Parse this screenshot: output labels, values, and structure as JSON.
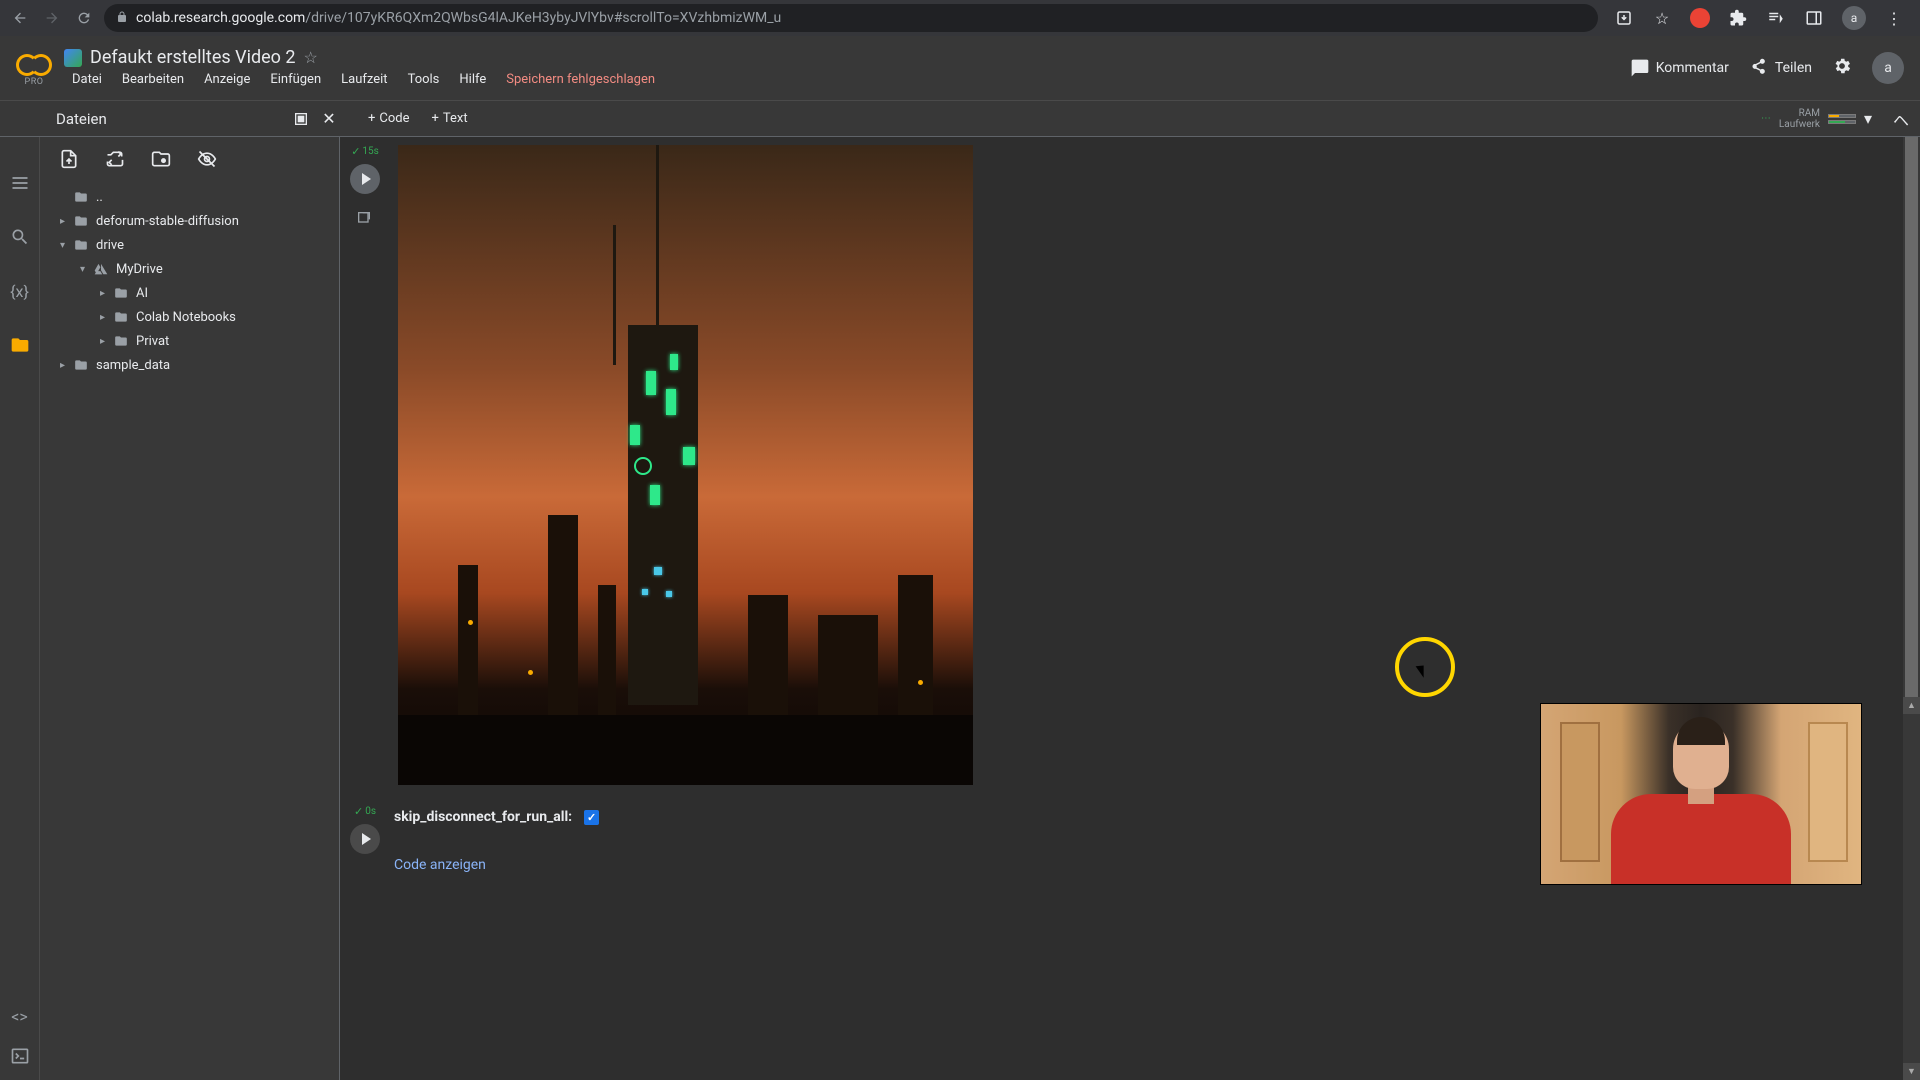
{
  "browser": {
    "url_prefix": "colab.research.google.com",
    "url_path": "/drive/107yKR6QXm2QWbsG4lAJKeH3ybyJVlYbv#scrollTo=XVzhbmizWM_u",
    "avatar_letter": "a"
  },
  "header": {
    "pro_badge": "PRO",
    "doc_title": "Defaukt erstelltes Video 2",
    "menus": [
      "Datei",
      "Bearbeiten",
      "Anzeige",
      "Einfügen",
      "Laufzeit",
      "Tools",
      "Hilfe"
    ],
    "save_error": "Speichern fehlgeschlagen",
    "kommentar": "Kommentar",
    "teilen": "Teilen",
    "avatar_letter": "a"
  },
  "toolbar": {
    "code_btn": "Code",
    "text_btn": "Text",
    "ram_label": "RAM",
    "disk_label": "Laufwerk"
  },
  "files_panel": {
    "title": "Dateien",
    "tree": {
      "up": "..",
      "deforum": "deforum-stable-diffusion",
      "drive": "drive",
      "mydrive": "MyDrive",
      "ai": "AI",
      "colab_nb": "Colab Notebooks",
      "privat": "Privat",
      "sample": "sample_data"
    }
  },
  "cells": {
    "c1": {
      "exec_time": "15s"
    },
    "c2": {
      "exec_time": "0s",
      "param_label": "skip_disconnect_for_run_all:",
      "checked": true,
      "code_link": "Code anzeigen"
    }
  }
}
